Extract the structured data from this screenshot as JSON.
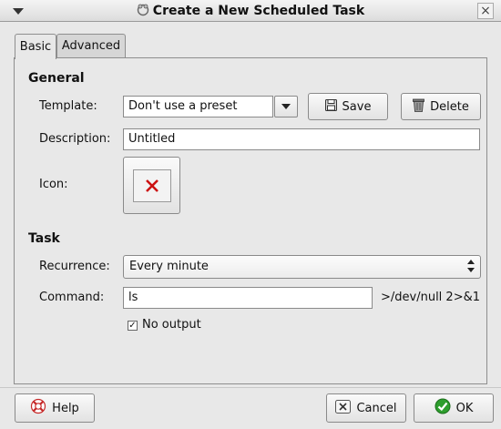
{
  "window": {
    "title": "Create a New Scheduled Task",
    "close_glyph": "×"
  },
  "tabs": [
    {
      "label": "Basic",
      "active": true
    },
    {
      "label": "Advanced",
      "active": false
    }
  ],
  "general": {
    "heading": "General",
    "template_label": "Template:",
    "template_value": "Don't use a preset",
    "save_label": "Save",
    "delete_label": "Delete",
    "description_label": "Description:",
    "description_value": "Untitled",
    "icon_label": "Icon:",
    "icon_name": "red-x-icon"
  },
  "task": {
    "heading": "Task",
    "recurrence_label": "Recurrence:",
    "recurrence_value": "Every minute",
    "command_label": "Command:",
    "command_value": "ls",
    "command_suffix": ">/dev/null 2>&1",
    "no_output_label": "No output",
    "no_output_checked": true
  },
  "buttons": {
    "help": "Help",
    "cancel": "Cancel",
    "ok": "OK"
  },
  "colors": {
    "ok_icon": "#2e9e2e",
    "delete_x": "#cc1111"
  }
}
